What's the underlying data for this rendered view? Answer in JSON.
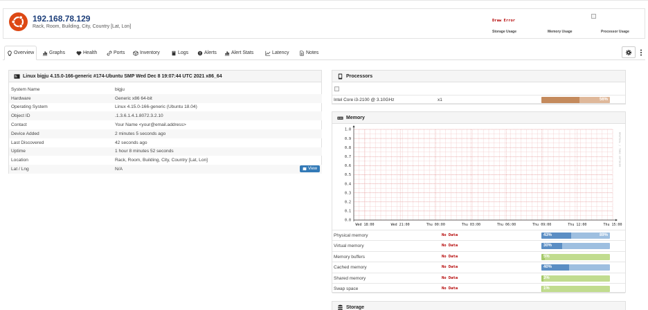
{
  "device": {
    "hostname": "192.168.78.129",
    "location_line": "Rack, Room, Building, City, Country [Lat, Lon]"
  },
  "header_graphs": {
    "error_text": "Draw Error",
    "labels": [
      "Storage Usage",
      "Memory Usage",
      "Processor Usage"
    ]
  },
  "tabs": [
    {
      "label": "Overview",
      "icon": "lightbulb-icon",
      "active": true
    },
    {
      "label": "Graphs",
      "icon": "bar-chart-icon"
    },
    {
      "label": "Health",
      "icon": "heartbeat-icon"
    },
    {
      "label": "Ports",
      "icon": "link-icon"
    },
    {
      "label": "Inventory",
      "icon": "cube-icon"
    },
    {
      "label": "Logs",
      "icon": "book-icon"
    },
    {
      "label": "Alerts",
      "icon": "exclamation-circle-icon"
    },
    {
      "label": "Alert Stats",
      "icon": "bar-chart-icon"
    },
    {
      "label": "Latency",
      "icon": "line-chart-icon"
    },
    {
      "label": "Notes",
      "icon": "file-text-icon"
    }
  ],
  "overview": {
    "title": "Linux bigju 4.15.0-166-generic #174-Ubuntu SMP Wed Dec 8 19:07:44 UTC 2021 x86_64",
    "rows": [
      {
        "key": "System Name",
        "value": "bigju"
      },
      {
        "key": "Hardware",
        "value": "Generic x86 64-bit"
      },
      {
        "key": "Operating System",
        "value": "Linux 4.15.0-166-generic (Ubuntu 18.04)"
      },
      {
        "key": "Object ID",
        "value": ".1.3.6.1.4.1.8072.3.2.10"
      },
      {
        "key": "Contact",
        "value": "Your Name <your@email.address>"
      },
      {
        "key": "Device Added",
        "value": "2 minutes 5 seconds ago"
      },
      {
        "key": "Last Discovered",
        "value": "42 seconds ago"
      },
      {
        "key": "Uptime",
        "value": "1 hour 8 minutes 52 seconds"
      },
      {
        "key": "Location",
        "value": "Rack, Room, Building, City, Country [Lat, Lon]"
      },
      {
        "key": "Lat / Lng",
        "value": "N/A"
      }
    ],
    "view_button": "View"
  },
  "processors": {
    "title": "Processors",
    "items": [
      {
        "name": "Intel Core i3-2100 @ 3.10GHz",
        "count": "x1",
        "percent": 56,
        "percent_label": "56%"
      }
    ]
  },
  "memory": {
    "title": "Memory",
    "rrd_watermark": "RRDTOOL / TOBI OETIKER",
    "no_data_text": "No Data",
    "items": [
      {
        "name": "Physical memory",
        "used": 43,
        "used_label": "43%",
        "secondary": 89,
        "secondary_label": "89%",
        "color": "#5b8ec4",
        "rest_color": "#9ebfe0"
      },
      {
        "name": "Virtual memory",
        "used": 30,
        "used_label": "30%",
        "color": "#5b8ec4",
        "rest_color": "#9ebfe0"
      },
      {
        "name": "Memory buffers",
        "used": 5,
        "used_label": "5%",
        "color": "#a6c96a",
        "rest_color": "#c1dc8f"
      },
      {
        "name": "Cached memory",
        "used": 40,
        "used_label": "40%",
        "color": "#5b8ec4",
        "rest_color": "#9ebfe0"
      },
      {
        "name": "Shared memory",
        "used": 3,
        "used_label": "3%",
        "color": "#a6c96a",
        "rest_color": "#c1dc8f"
      },
      {
        "name": "Swap space",
        "used": 1,
        "used_label": "1%",
        "color": "#a6c96a",
        "rest_color": "#c1dc8f"
      }
    ]
  },
  "storage": {
    "title": "Storage"
  },
  "colors": {
    "proc_fill": "#c48a5c",
    "proc_rest": "#dfb89a",
    "ubuntu_orange": "#dd4814"
  },
  "chart_data": {
    "type": "area",
    "title": "",
    "xlabel": "",
    "ylabel": "",
    "categories": [
      "Wed 18:00",
      "Wed 21:00",
      "Thu 00:00",
      "Thu 03:00",
      "Thu 06:00",
      "Thu 09:00",
      "Thu 12:00",
      "Thu 15:00"
    ],
    "y_ticks": [
      "0.0",
      "0.1",
      "0.2",
      "0.3",
      "0.4",
      "0.5",
      "0.6",
      "0.7",
      "0.8",
      "0.9",
      "1.0"
    ],
    "ylim": [
      0,
      1.0
    ],
    "grid": true,
    "series": []
  }
}
